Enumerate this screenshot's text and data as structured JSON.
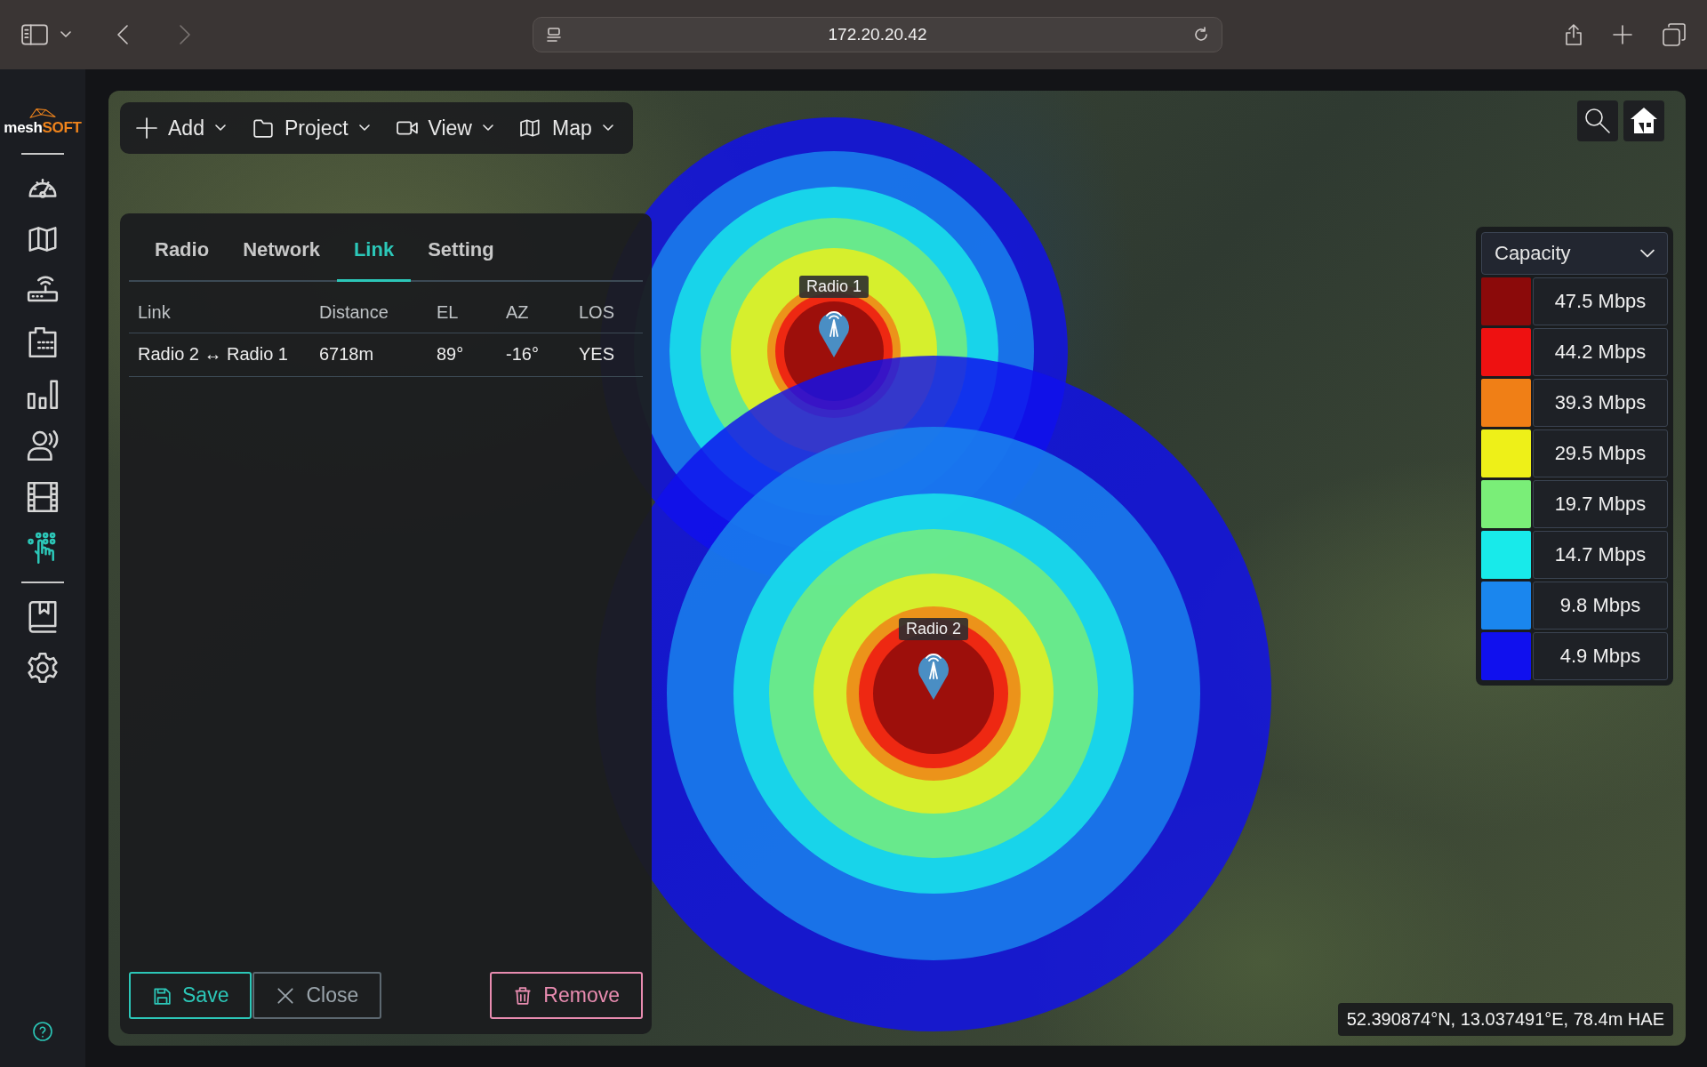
{
  "browser": {
    "address": "172.20.20.42"
  },
  "sidebar": {
    "logo_main": "mesh",
    "logo_accent": "SOFT",
    "sections": [
      {
        "items": [
          {
            "selected": false
          },
          {
            "selected": false
          },
          {
            "selected": false
          },
          {
            "selected": false
          },
          {
            "selected": false
          },
          {
            "selected": false
          },
          {
            "selected": false
          },
          {
            "selected": true
          }
        ]
      },
      {
        "items": [
          {
            "selected": false
          },
          {
            "selected": false
          }
        ]
      }
    ]
  },
  "toolbar": {
    "menus": [
      {
        "label": "Add"
      },
      {
        "label": "Project"
      },
      {
        "label": "View"
      },
      {
        "label": "Map"
      }
    ]
  },
  "panel": {
    "tabs": [
      {
        "label": "Radio",
        "selected": false
      },
      {
        "label": "Network",
        "selected": false
      },
      {
        "label": "Link",
        "selected": true
      },
      {
        "label": "Setting",
        "selected": false
      }
    ],
    "table": {
      "columns": [
        "Link",
        "Distance",
        "EL",
        "AZ",
        "LOS"
      ],
      "rows": [
        [
          "Radio 2 ↔ Radio 1",
          "6718m",
          "89°",
          "-16°",
          "YES"
        ]
      ]
    },
    "buttons": [
      {
        "label": "Save",
        "kind": "save"
      },
      {
        "label": "Close",
        "kind": "close"
      },
      {
        "label": "Remove",
        "kind": "remove"
      }
    ]
  },
  "map": {
    "radios": [
      {
        "label": "Radio 1"
      },
      {
        "label": "Radio 2"
      }
    ],
    "coordinates": "52.390874°N, 13.037491°E, 78.4m HAE"
  },
  "legend": {
    "title": "Capacity",
    "entries": [
      {
        "label": "47.5 Mbps",
        "color": "#8b0a0a"
      },
      {
        "label": "44.2 Mbps",
        "color": "#ee1111"
      },
      {
        "label": "39.3 Mbps",
        "color": "#f07f16"
      },
      {
        "label": "29.5 Mbps",
        "color": "#eef018"
      },
      {
        "label": "19.7 Mbps",
        "color": "#7aee78"
      },
      {
        "label": "14.7 Mbps",
        "color": "#18eaea"
      },
      {
        "label": "9.8 Mbps",
        "color": "#1a86ee"
      },
      {
        "label": "4.9 Mbps",
        "color": "#1010ee"
      }
    ]
  }
}
